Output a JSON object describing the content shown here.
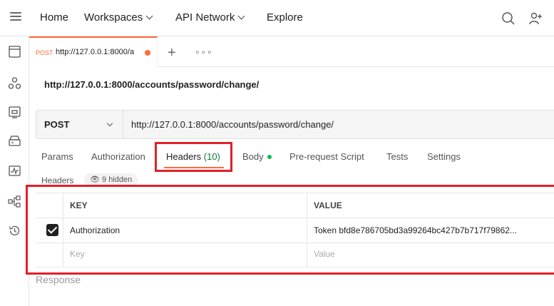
{
  "nav": {
    "home": "Home",
    "workspaces": "Workspaces",
    "api_network": "API Network",
    "explore": "Explore"
  },
  "tab": {
    "method": "POST",
    "url": "http://127.0.0.1:8000/a"
  },
  "request": {
    "title": "http://127.0.0.1:8000/accounts/password/change/",
    "method": "POST",
    "url": "http://127.0.0.1:8000/accounts/password/change/"
  },
  "subtabs": {
    "params": "Params",
    "authorization": "Authorization",
    "headers": "Headers",
    "headers_count": "(10)",
    "body": "Body",
    "prerequest": "Pre-request Script",
    "tests": "Tests",
    "settings": "Settings"
  },
  "headers_section": {
    "label": "Headers",
    "hidden": "9 hidden"
  },
  "table": {
    "col_key": "KEY",
    "col_value": "VALUE",
    "rows": [
      {
        "key": "Authorization",
        "value": "Token bfd8e786705bd3a99264bc427b7b717f79862...",
        "checked": true
      }
    ],
    "placeholder_key": "Key",
    "placeholder_value": "Value"
  },
  "response_label": "Response",
  "colors": {
    "accent": "#ff6c37",
    "highlight": "#e0202a",
    "body_dot": "#0cbb52"
  }
}
